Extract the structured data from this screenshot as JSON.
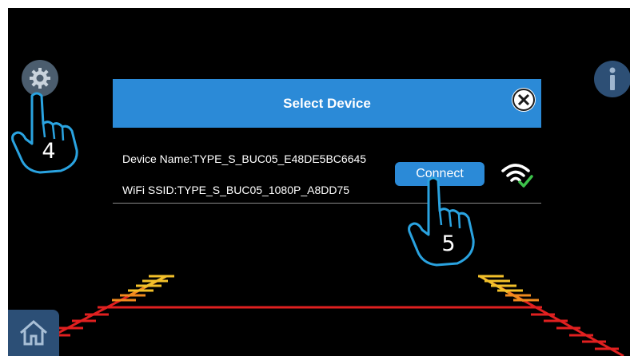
{
  "dialog": {
    "title": "Select Device",
    "device_name": "Device Name:TYPE_S_BUC05_E48DE5BC6645",
    "wifi_ssid": "WiFi SSID:TYPE_S_BUC05_1080P_A8DD75",
    "connect_label": "Connect"
  },
  "callouts": {
    "step_settings": "4",
    "step_connect": "5"
  },
  "icons": {
    "settings": "gear-icon",
    "info": "info-icon",
    "home": "home-icon",
    "close": "close-icon",
    "wifi": "wifi-connected-icon",
    "pointer": "pointing-hand-icon"
  },
  "colors": {
    "dialog_header": "#2b8ad7",
    "button": "#2b8ad7",
    "callout_outline": "#2aa3e0",
    "guide_red": "#e02020",
    "guide_yellow": "#f2c02a",
    "guide_orange": "#f08a1e"
  }
}
